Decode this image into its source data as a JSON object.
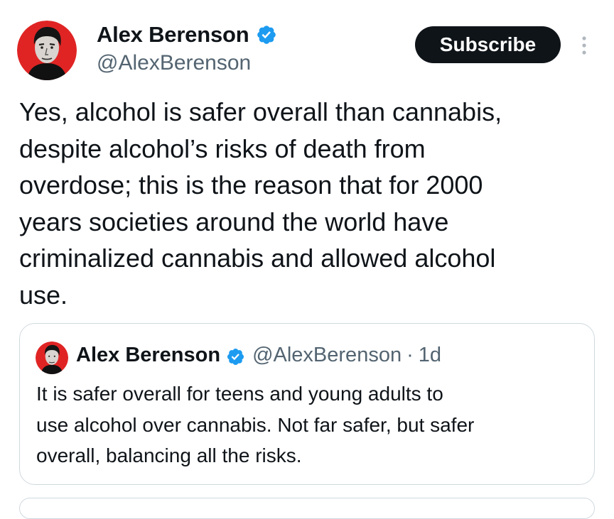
{
  "tweet": {
    "author": {
      "display_name": "Alex Berenson",
      "handle": "@AlexBerenson",
      "verified": true,
      "avatar_icon": "portrait-avatar-icon"
    },
    "subscribe_label": "Subscribe",
    "more_icon": "vertical-ellipsis-icon",
    "text": "Yes, alcohol is safer overall than cannabis,\ndespite alcohol’s risks of death from\noverdose; this is the reason that for 2000\nyears societies around the world have\ncriminalized cannabis and allowed alcohol\nuse."
  },
  "quoted_tweet": {
    "author": {
      "display_name": "Alex Berenson",
      "handle": "@AlexBerenson",
      "verified": true
    },
    "separator": "·",
    "time": "1d",
    "text": "It is safer overall for teens and young adults to\nuse alcohol over cannabis. Not far safer, but safer\noverall, balancing all the risks."
  },
  "colors": {
    "text_primary": "#0f1419",
    "text_secondary": "#536471",
    "verified_blue": "#1d9bf0",
    "button_bg": "#0f1419",
    "border": "#cfd9de",
    "avatar_red": "#e02424"
  }
}
